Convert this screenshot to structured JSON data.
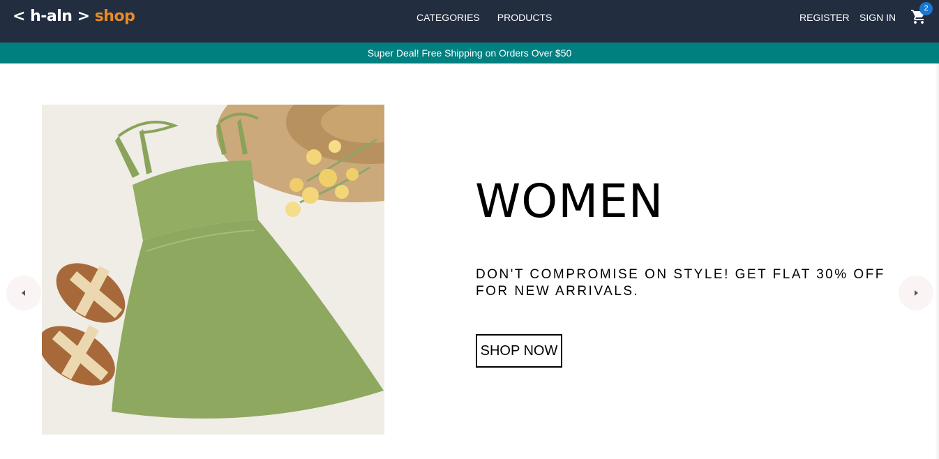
{
  "header": {
    "logo": {
      "brackets_left": "< h-aln >",
      "shop": "shop"
    },
    "nav_center": [
      "CATEGORIES",
      "PRODUCTS"
    ],
    "nav_right": {
      "register": "REGISTER",
      "sign_in": "SIGN IN"
    },
    "cart": {
      "icon": "shopping-cart-icon",
      "count": "2",
      "badge_color": "#1976d2"
    },
    "background": "#222d40",
    "brand_accent": "#e88a26"
  },
  "announcement": {
    "text": "Super Deal! Free Shipping on Orders Over $50",
    "background": "#008080"
  },
  "slider": {
    "title": "WOMEN",
    "description": "DON'T COMPROMISE ON STYLE! GET FLAT 30% OFF FOR NEW ARRIVALS.",
    "button": "SHOP NOW",
    "left_arrow_icon": "arrow-left-icon",
    "right_arrow_icon": "arrow-right-icon"
  }
}
